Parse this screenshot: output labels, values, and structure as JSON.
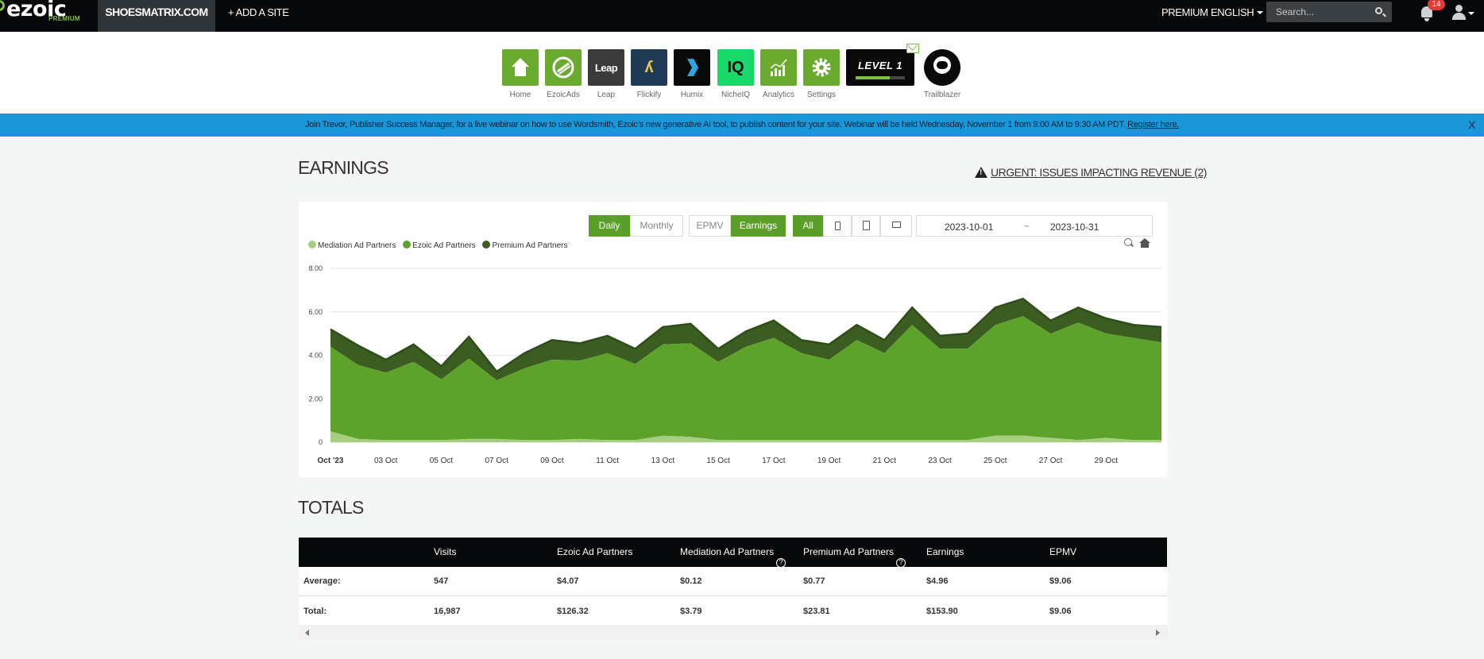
{
  "topbar": {
    "logo_text": "ezoic",
    "logo_sub": "PREMIUM",
    "site_name": "SHOESMATRIX.COM",
    "add_site": "+ ADD A SITE",
    "premium": "PREMIUM",
    "language": "ENGLISH",
    "search_placeholder": "Search...",
    "notification_count": "14"
  },
  "apps": [
    {
      "label": "Home",
      "icon": "home-icon",
      "color": "#6aaa2e"
    },
    {
      "label": "EzoicAds",
      "icon": "ezoicads-icon",
      "color": "#6aaa2e"
    },
    {
      "label": "Leap",
      "icon": "leap-icon",
      "color": "#3b3b3b"
    },
    {
      "label": "Flickify",
      "icon": "flickify-icon",
      "color": "#1f3a55"
    },
    {
      "label": "Humix",
      "icon": "humix-icon",
      "color": "#0a0a0a"
    },
    {
      "label": "NicheIQ",
      "icon": "nicheiq-icon",
      "color": "#19d86a"
    },
    {
      "label": "Analytics",
      "icon": "analytics-icon",
      "color": "#6aaa2e"
    },
    {
      "label": "Settings",
      "icon": "settings-icon",
      "color": "#6aaa2e"
    }
  ],
  "level": {
    "text": "LEVEL 1",
    "progress": 0.7
  },
  "trailblazer": {
    "label": "Trailblazer"
  },
  "banner": {
    "text": "Join Trevor, Publisher Success Manager, for a live webinar on how to use Wordsmith, Ezoic's new generative AI tool, to publish content for your site. Webinar will be held Wednesday, November 1 from 9:00 AM to 9:30 AM PDT. ",
    "link": "Register here.",
    "close": "X"
  },
  "earnings": {
    "title": "EARNINGS",
    "urgent": "URGENT: ISSUES IMPACTING REVENUE (2)",
    "buttons": {
      "daily": "Daily",
      "monthly": "Monthly",
      "epmv": "EPMV",
      "earnings": "Earnings",
      "all": "All"
    },
    "date_from": "2023-10-01",
    "date_sep": "~",
    "date_to": "2023-10-31"
  },
  "chart_data": {
    "type": "area",
    "stacked": true,
    "legend": [
      "Mediation Ad Partners",
      "Ezoic Ad Partners",
      "Premium Ad Partners"
    ],
    "colors": [
      "#a5cf7e",
      "#5da22a",
      "#3c5d22"
    ],
    "y_ticks": [
      "0",
      "2.00",
      "4.00",
      "6.00",
      "8.00"
    ],
    "ylim": [
      0,
      8
    ],
    "x_ticks": [
      "Oct '23",
      "03 Oct",
      "05 Oct",
      "07 Oct",
      "09 Oct",
      "11 Oct",
      "13 Oct",
      "15 Oct",
      "17 Oct",
      "19 Oct",
      "21 Oct",
      "23 Oct",
      "25 Oct",
      "27 Oct",
      "29 Oct"
    ],
    "x": [
      "2023-10-01",
      "2023-10-02",
      "2023-10-03",
      "2023-10-04",
      "2023-10-05",
      "2023-10-06",
      "2023-10-07",
      "2023-10-08",
      "2023-10-09",
      "2023-10-10",
      "2023-10-11",
      "2023-10-12",
      "2023-10-13",
      "2023-10-14",
      "2023-10-15",
      "2023-10-16",
      "2023-10-17",
      "2023-10-18",
      "2023-10-19",
      "2023-10-20",
      "2023-10-21",
      "2023-10-22",
      "2023-10-23",
      "2023-10-24",
      "2023-10-25",
      "2023-10-26",
      "2023-10-27",
      "2023-10-28",
      "2023-10-29",
      "2023-10-30",
      "2023-10-31"
    ],
    "series": [
      {
        "name": "Mediation Ad Partners",
        "values": [
          0.5,
          0.15,
          0.1,
          0.1,
          0.1,
          0.15,
          0.15,
          0.1,
          0.1,
          0.15,
          0.1,
          0.1,
          0.3,
          0.25,
          0.1,
          0.1,
          0.1,
          0.1,
          0.1,
          0.1,
          0.1,
          0.1,
          0.1,
          0.1,
          0.3,
          0.3,
          0.2,
          0.1,
          0.2,
          0.1,
          0.1
        ]
      },
      {
        "name": "Ezoic Ad Partners",
        "values": [
          3.9,
          3.4,
          3.1,
          3.6,
          2.8,
          3.7,
          2.7,
          3.3,
          3.7,
          3.6,
          4.0,
          3.5,
          4.2,
          4.3,
          3.6,
          4.3,
          4.7,
          4.0,
          3.7,
          4.6,
          4.0,
          5.3,
          4.2,
          4.2,
          5.1,
          5.5,
          4.8,
          5.4,
          4.8,
          4.7,
          4.5
        ]
      },
      {
        "name": "Premium Ad Partners",
        "values": [
          0.8,
          0.9,
          0.6,
          0.8,
          0.6,
          1.0,
          0.4,
          0.7,
          0.9,
          0.8,
          0.8,
          0.7,
          0.8,
          0.9,
          0.6,
          0.7,
          0.8,
          0.6,
          0.7,
          0.7,
          0.6,
          0.8,
          0.6,
          0.7,
          0.8,
          0.8,
          0.6,
          0.7,
          0.7,
          0.6,
          0.7
        ]
      }
    ]
  },
  "totals": {
    "title": "TOTALS",
    "headers": [
      "",
      "Visits",
      "Ezoic Ad Partners",
      "Mediation Ad Partners",
      "Premium Ad Partners",
      "Earnings",
      "EPMV"
    ],
    "rows": [
      [
        "Average:",
        "547",
        "$4.07",
        "$0.12",
        "$0.77",
        "$4.96",
        "$9.06"
      ],
      [
        "Total:",
        "16,987",
        "$126.32",
        "$3.79",
        "$23.81",
        "$153.90",
        "$9.06"
      ]
    ]
  }
}
